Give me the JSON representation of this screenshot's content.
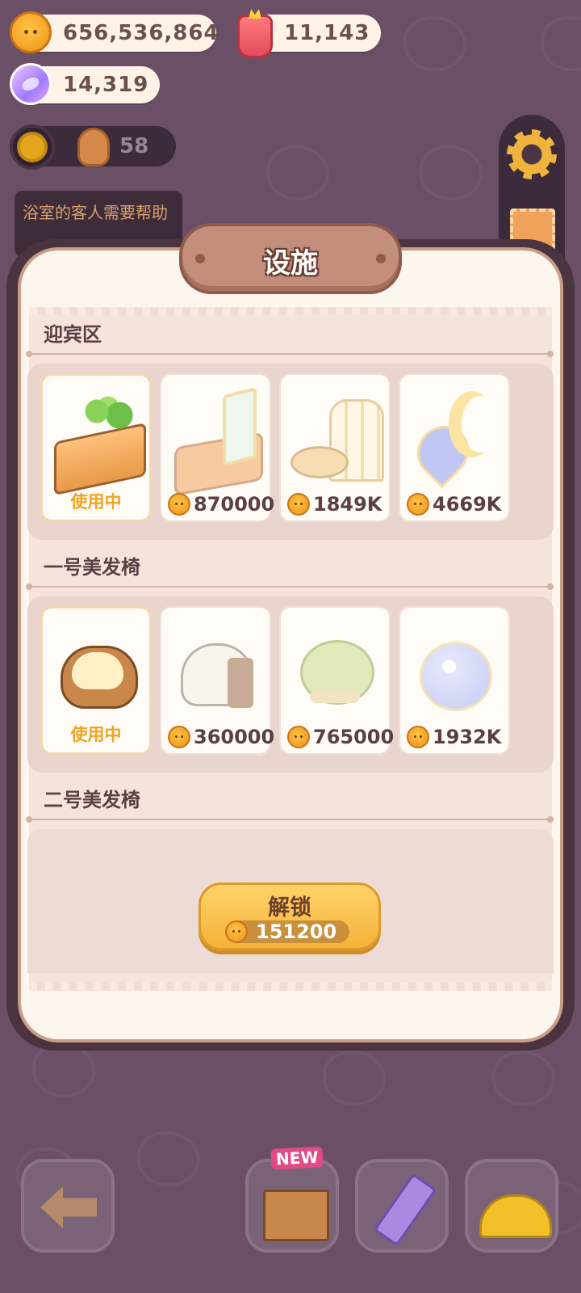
{
  "currencies": {
    "coins": "656,536,864",
    "jam": "11,143",
    "gems": "14,319"
  },
  "player": {
    "customer_count": "58",
    "tip_message": "浴室的客人需要帮助"
  },
  "panel": {
    "title": "设施"
  },
  "sections": [
    {
      "title": "迎宾区",
      "items": [
        {
          "status": "使用中",
          "price": "",
          "icon": "reception-counter-clover"
        },
        {
          "status": "",
          "price": "870000",
          "icon": "mushroom-mirror-counter"
        },
        {
          "status": "",
          "price": "1849K",
          "icon": "golden-screen-table"
        },
        {
          "status": "",
          "price": "4669K",
          "icon": "moon-heart-counter"
        }
      ]
    },
    {
      "title": "一号美发椅",
      "items": [
        {
          "status": "使用中",
          "price": "",
          "icon": "wooden-armchair"
        },
        {
          "status": "",
          "price": "360000",
          "icon": "sheep-chair"
        },
        {
          "status": "",
          "price": "765000",
          "icon": "green-cushion-chair"
        },
        {
          "status": "",
          "price": "1932K",
          "icon": "starry-orb-chair"
        }
      ]
    },
    {
      "title": "二号美发椅",
      "unlock": {
        "label": "解锁",
        "cost": "151200"
      }
    }
  ],
  "bottom_bar": {
    "new_badge": "NEW",
    "buttons": [
      "back-arrow-icon",
      "gift-box-icon",
      "pencil-icon",
      "hard-hat-icon"
    ]
  },
  "colors": {
    "background": "#6a4f66",
    "panel": "#fdf6ee",
    "accent_gold": "#f0a31f",
    "unlock_button": "#f5b23a"
  }
}
